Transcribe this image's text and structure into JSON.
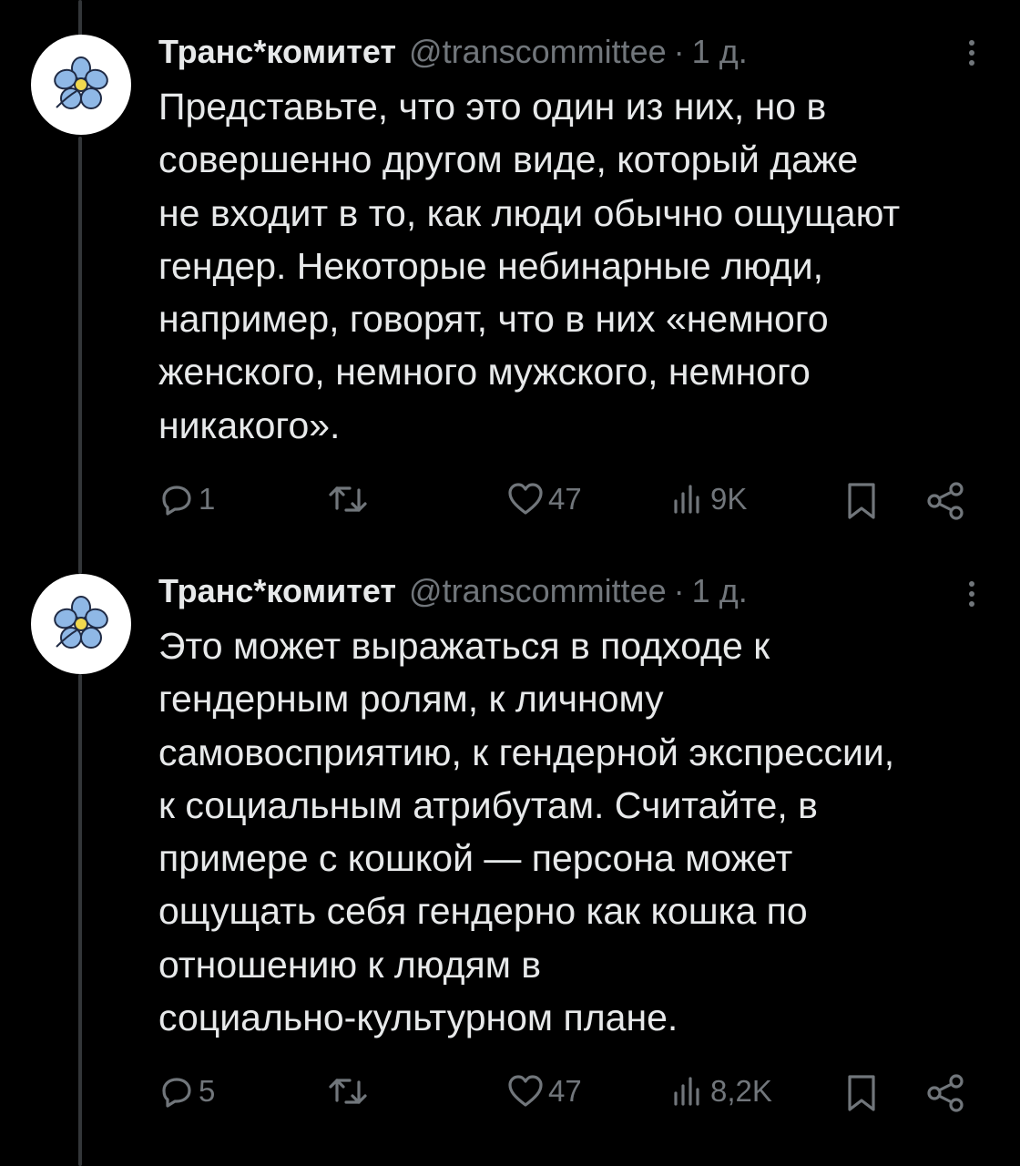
{
  "tweets": [
    {
      "author_name": "Транс*комитет",
      "author_handle": "@transcommittee",
      "separator": "·",
      "time": "1 д.",
      "text": "Представьте, что это один из них, но в\nсовершенно другом виде, который даже\nне входит в то, как люди обычно ощущают\nгендер. Некоторые небинарные люди,\nнапример, говорят, что в них «немного\nженского, немного мужского, немного\nникакого».",
      "replies": "1",
      "likes": "47",
      "views": "9K"
    },
    {
      "author_name": "Транс*комитет",
      "author_handle": "@transcommittee",
      "separator": "·",
      "time": "1 д.",
      "text": "Это может выражаться в подходе к\nгендерным ролям, к личному\nсамовосприятию, к гендерной экспрессии,\nк социальным атрибутам. Считайте, в\nпримере с кошкой — персона может\nощущать себя гендерно как кошка по\nотношению к людям в\nсоциально-культурном плане.",
      "replies": "5",
      "likes": "47",
      "views": "8,2K"
    }
  ],
  "icons": {
    "avatar": "forget-me-not-flower-icon",
    "more": "more-vertical-icon",
    "reply": "reply-icon",
    "retweet": "retweet-icon",
    "like": "heart-icon",
    "views": "views-chart-icon",
    "bookmark": "bookmark-icon",
    "share": "share-icon"
  },
  "colors": {
    "background": "#000000",
    "text": "#e7e9ea",
    "muted": "#71767b",
    "avatar_flower": "#8fb8e6"
  }
}
